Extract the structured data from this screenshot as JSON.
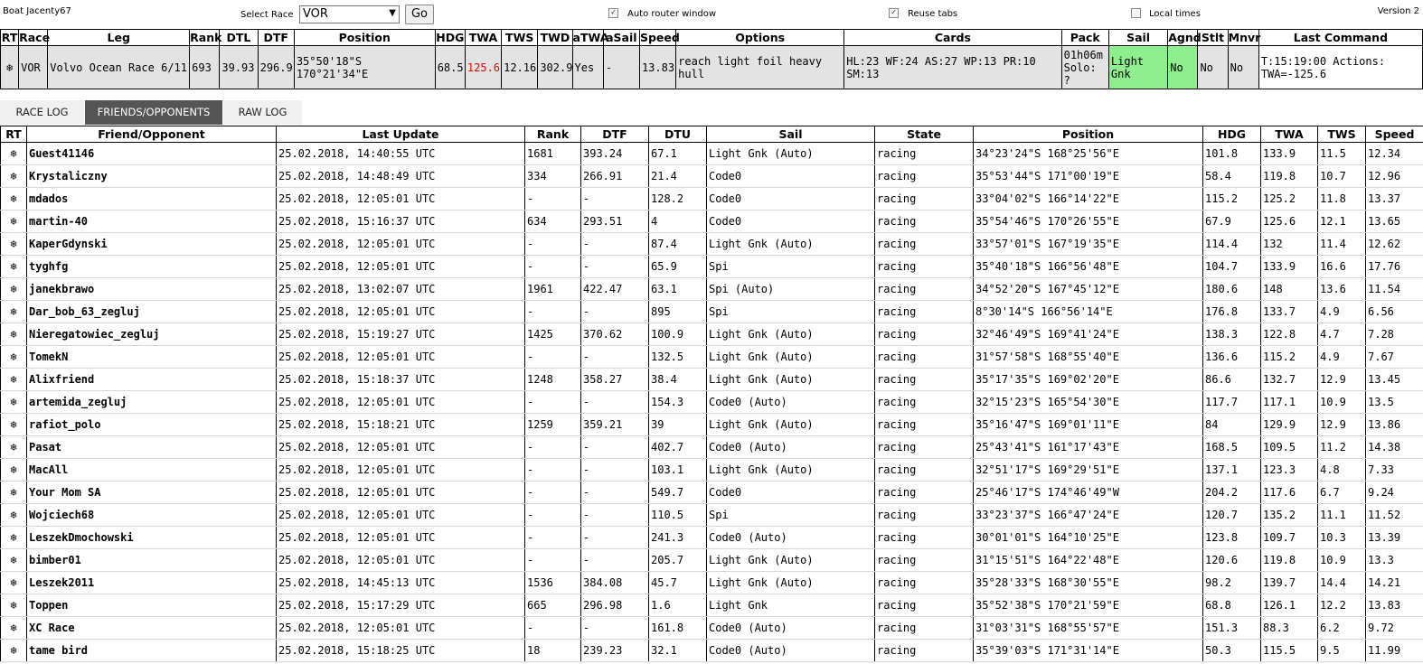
{
  "topbar": {
    "boat_label": "Boat Jacenty67",
    "select_race_label": "Select Race",
    "race_selected": "VOR",
    "go_label": "Go",
    "auto_router_label": "Auto router window",
    "auto_router_checked": true,
    "reuse_tabs_label": "Reuse tabs",
    "reuse_tabs_checked": true,
    "local_times_label": "Local times",
    "local_times_checked": false,
    "version": "Version 2"
  },
  "status": {
    "headers": [
      "RT",
      "Race",
      "Leg",
      "Rank",
      "DTL",
      "DTF",
      "Position",
      "HDG",
      "TWA",
      "TWS",
      "TWD",
      "aTWA",
      "aSail",
      "Speed",
      "Options",
      "Cards",
      "Pack",
      "Sail",
      "Agnd",
      "Stlt",
      "Mnvr",
      "Last Command"
    ],
    "row": {
      "rt": "❄",
      "race": "VOR",
      "leg": "Volvo Ocean Race 6/11",
      "rank": "693",
      "dtl": "39.93",
      "dtf": "296.9",
      "position": "35°50'18\"S 170°21'34\"E",
      "hdg": "68.5",
      "twa": "125.6",
      "tws": "12.16",
      "twd": "302.9",
      "atwa": "Yes",
      "asail": "-",
      "speed": "13.83",
      "options": "reach light foil heavy hull",
      "cards": "HL:23 WF:24 AS:27 WP:13 PR:10 SM:13",
      "pack": "01h06m Solo: ?",
      "sail": "Light Gnk",
      "agnd": "No",
      "stlt": "No",
      "mnvr": "No",
      "last_command": "T:15:19:00 Actions: TWA=-125.6"
    },
    "twa_color": "#e00000",
    "sail_color": "#8fef8f"
  },
  "tabs": [
    "RACE LOG",
    "FRIENDS/OPPONENTS",
    "RAW LOG"
  ],
  "active_tab": "FRIENDS/OPPONENTS",
  "friends": {
    "headers": [
      "RT",
      "Friend/Opponent",
      "Last Update",
      "Rank",
      "DTF",
      "DTU",
      "Sail",
      "State",
      "Position",
      "HDG",
      "TWA",
      "TWS",
      "Speed"
    ],
    "rows": [
      [
        "❄",
        "Guest41146",
        "25.02.2018, 14:40:55 UTC",
        "1681",
        "393.24",
        "67.1",
        "Light Gnk (Auto)",
        "racing",
        "34°23'24\"S 168°25'56\"E",
        "101.8",
        "133.9",
        "11.5",
        "12.34"
      ],
      [
        "❄",
        "Krystaliczny",
        "25.02.2018, 14:48:49 UTC",
        "334",
        "266.91",
        "21.4",
        "Code0",
        "racing",
        "35°53'44\"S 171°00'19\"E",
        "58.4",
        "119.8",
        "10.7",
        "12.96"
      ],
      [
        "❄",
        "mdados",
        "25.02.2018, 12:05:01 UTC",
        "-",
        "-",
        "128.2",
        "Code0",
        "racing",
        "33°04'02\"S 166°14'22\"E",
        "115.2",
        "125.2",
        "11.8",
        "13.37"
      ],
      [
        "❄",
        "martin-40",
        "25.02.2018, 15:16:37 UTC",
        "634",
        "293.51",
        "4",
        "Code0",
        "racing",
        "35°54'46\"S 170°26'55\"E",
        "67.9",
        "125.6",
        "12.1",
        "13.65"
      ],
      [
        "❄",
        "KaperGdynski",
        "25.02.2018, 12:05:01 UTC",
        "-",
        "-",
        "87.4",
        "Light Gnk (Auto)",
        "racing",
        "33°57'01\"S 167°19'35\"E",
        "114.4",
        "132",
        "11.4",
        "12.62"
      ],
      [
        "❄",
        "tyghfg",
        "25.02.2018, 12:05:01 UTC",
        "-",
        "-",
        "65.9",
        "Spi",
        "racing",
        "35°40'18\"S 166°56'48\"E",
        "104.7",
        "133.9",
        "16.6",
        "17.76"
      ],
      [
        "❄",
        "janekbrawo",
        "25.02.2018, 13:02:07 UTC",
        "1961",
        "422.47",
        "63.1",
        "Spi (Auto)",
        "racing",
        "34°52'20\"S 167°45'12\"E",
        "180.6",
        "148",
        "13.6",
        "11.54"
      ],
      [
        "❄",
        "Dar_bob_63_zegluj",
        "25.02.2018, 12:05:01 UTC",
        "-",
        "-",
        "895",
        "Spi",
        "racing",
        "8°30'14\"S 166°56'14\"E",
        "176.8",
        "133.7",
        "4.9",
        "6.56"
      ],
      [
        "❄",
        "Nieregatowiec_zegluj",
        "25.02.2018, 15:19:27 UTC",
        "1425",
        "370.62",
        "100.9",
        "Light Gnk (Auto)",
        "racing",
        "32°46'49\"S 169°41'24\"E",
        "138.3",
        "122.8",
        "4.7",
        "7.28"
      ],
      [
        "❄",
        "TomekN",
        "25.02.2018, 12:05:01 UTC",
        "-",
        "-",
        "132.5",
        "Light Gnk (Auto)",
        "racing",
        "31°57'58\"S 168°55'40\"E",
        "136.6",
        "115.2",
        "4.9",
        "7.67"
      ],
      [
        "❄",
        "Alixfriend",
        "25.02.2018, 15:18:37 UTC",
        "1248",
        "358.27",
        "38.4",
        "Light Gnk (Auto)",
        "racing",
        "35°17'35\"S 169°02'20\"E",
        "86.6",
        "132.7",
        "12.9",
        "13.45"
      ],
      [
        "❄",
        "artemida_zegluj",
        "25.02.2018, 12:05:01 UTC",
        "-",
        "-",
        "154.3",
        "Code0 (Auto)",
        "racing",
        "32°15'23\"S 165°54'30\"E",
        "117.7",
        "117.1",
        "10.9",
        "13.5"
      ],
      [
        "❄",
        "rafiot_polo",
        "25.02.2018, 15:18:21 UTC",
        "1259",
        "359.21",
        "39",
        "Light Gnk (Auto)",
        "racing",
        "35°16'47\"S 169°01'11\"E",
        "84",
        "129.9",
        "12.9",
        "13.86"
      ],
      [
        "❄",
        "Pasat",
        "25.02.2018, 12:05:01 UTC",
        "-",
        "-",
        "402.7",
        "Code0 (Auto)",
        "racing",
        "25°43'41\"S 161°17'43\"E",
        "168.5",
        "109.5",
        "11.2",
        "14.38"
      ],
      [
        "❄",
        "MacAll",
        "25.02.2018, 12:05:01 UTC",
        "-",
        "-",
        "103.1",
        "Light Gnk (Auto)",
        "racing",
        "32°51'17\"S 169°29'51\"E",
        "137.1",
        "123.3",
        "4.8",
        "7.33"
      ],
      [
        "❄",
        "Your Mom SA",
        "25.02.2018, 12:05:01 UTC",
        "-",
        "-",
        "549.7",
        "Code0",
        "racing",
        "25°46'17\"S 174°46'49\"W",
        "204.2",
        "117.6",
        "6.7",
        "9.24"
      ],
      [
        "❄",
        "Wojciech68",
        "25.02.2018, 12:05:01 UTC",
        "-",
        "-",
        "110.5",
        "Spi",
        "racing",
        "33°23'37\"S 166°47'24\"E",
        "120.7",
        "135.2",
        "11.1",
        "11.52"
      ],
      [
        "❄",
        "LeszekDmochowski",
        "25.02.2018, 12:05:01 UTC",
        "-",
        "-",
        "241.3",
        "Code0 (Auto)",
        "racing",
        "30°01'01\"S 164°10'25\"E",
        "123.8",
        "109.7",
        "10.3",
        "13.39"
      ],
      [
        "❄",
        "bimber01",
        "25.02.2018, 12:05:01 UTC",
        "-",
        "-",
        "205.7",
        "Light Gnk (Auto)",
        "racing",
        "31°15'51\"S 164°22'48\"E",
        "120.6",
        "119.8",
        "10.9",
        "13.3"
      ],
      [
        "❄",
        "Leszek2011",
        "25.02.2018, 14:45:13 UTC",
        "1536",
        "384.08",
        "45.7",
        "Light Gnk (Auto)",
        "racing",
        "35°28'33\"S 168°30'55\"E",
        "98.2",
        "139.7",
        "14.4",
        "14.21"
      ],
      [
        "❄",
        "Toppen",
        "25.02.2018, 15:17:29 UTC",
        "665",
        "296.98",
        "1.6",
        "Light Gnk",
        "racing",
        "35°52'38\"S 170°21'59\"E",
        "68.8",
        "126.1",
        "12.2",
        "13.83"
      ],
      [
        "❄",
        "XC Race",
        "25.02.2018, 12:05:01 UTC",
        "-",
        "-",
        "161.8",
        "Code0 (Auto)",
        "racing",
        "31°03'31\"S 168°55'57\"E",
        "151.3",
        "88.3",
        "6.2",
        "9.72"
      ],
      [
        "❄",
        "tame bird",
        "25.02.2018, 15:18:25 UTC",
        "18",
        "239.23",
        "32.1",
        "Code0 (Auto)",
        "racing",
        "35°39'03\"S 171°31'14\"E",
        "50.3",
        "115.5",
        "9.5",
        "11.99"
      ]
    ]
  }
}
